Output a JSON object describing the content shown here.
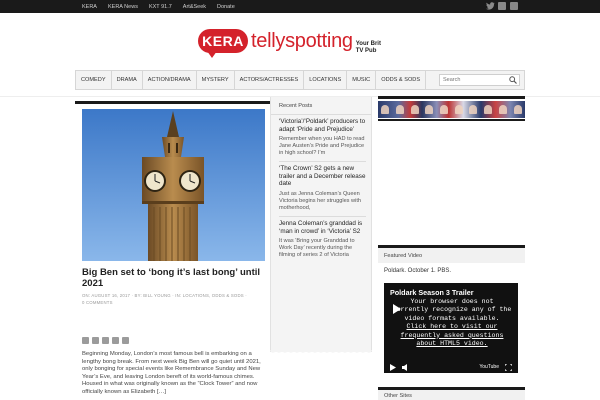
{
  "topbar": {
    "links": [
      "KERA",
      "KERA News",
      "KXT 91.7",
      "Art&Seek",
      "Donate"
    ],
    "social_icons": [
      "twitter-icon",
      "facebook-icon",
      "rss-icon"
    ]
  },
  "logo": {
    "badge": "KERA",
    "brand": "tellyspotting",
    "tagline_line1": "Your Brit",
    "tagline_line2": "TV Pub",
    "brand_color": "#d4222b"
  },
  "nav": {
    "items": [
      "COMEDY",
      "DRAMA",
      "ACTION/DRAMA",
      "MYSTERY",
      "ACTORS/ACTRESSES",
      "LOCATIONS",
      "MUSIC",
      "ODDS & SODS"
    ],
    "search_placeholder": "Search"
  },
  "post": {
    "title": "Big Ben set to ‘bong it’s last bong’ until 2021",
    "meta_line1": "ON: AUGUST 16, 2017 · BY: BILL YOUNG · IN: LOCATIONS, ODDS & SODS ·",
    "meta_line2": "0 COMMENTS",
    "share_icons": [
      "email-icon",
      "print-icon",
      "facebook-icon",
      "twitter-icon",
      "plus-icon"
    ],
    "excerpt": "Beginning Monday, London’s most famous bell is embarking on a lengthy bong break. From next week Big Ben will go quiet until 2021, only bonging for special events like Remembrance Sunday and New Year’s Eve, and leaving London bereft of its world-famous chimes. Housed in what was originally known as the “Clock Tower” and now officially known as Elizabeth […]"
  },
  "recent": {
    "heading": "Recent Posts",
    "items": [
      {
        "title": "‘Victoria’/‘Poldark’ producers to adapt ‘Pride and Prejudice’",
        "excerpt": "Remember when you HAD to read Jane Austen’s Pride and Prejudice in high school? I’m"
      },
      {
        "title": "‘The Crown’ S2 gets a new trailer and a December release date",
        "excerpt": "Just as Jenna Coleman’s Queen Victoria begins her struggles with motherhood,"
      },
      {
        "title": "Jenna Coleman’s granddad is ‘man in crowd’ in ‘Victoria’ S2",
        "excerpt": "It was ‘Bring your Granddad to Work Day’ recently during the filming of series 2 of Victoria"
      }
    ]
  },
  "sidebar": {
    "featured_video_heading": "Featured Video",
    "featured_video_caption": "Poldark. October 1. PBS.",
    "video_title": "Poldark Season 3 Trailer",
    "video_msg_line1": "Your browser does not",
    "video_msg_line2": "currently recognize any of the",
    "video_msg_line3": "video formats available.",
    "video_link1": "Click here to visit our",
    "video_link2": "frequently asked questions",
    "video_link3": "about HTML5 video.",
    "youtube_label": "YouTube",
    "other_sites_heading": "Other Sites"
  }
}
